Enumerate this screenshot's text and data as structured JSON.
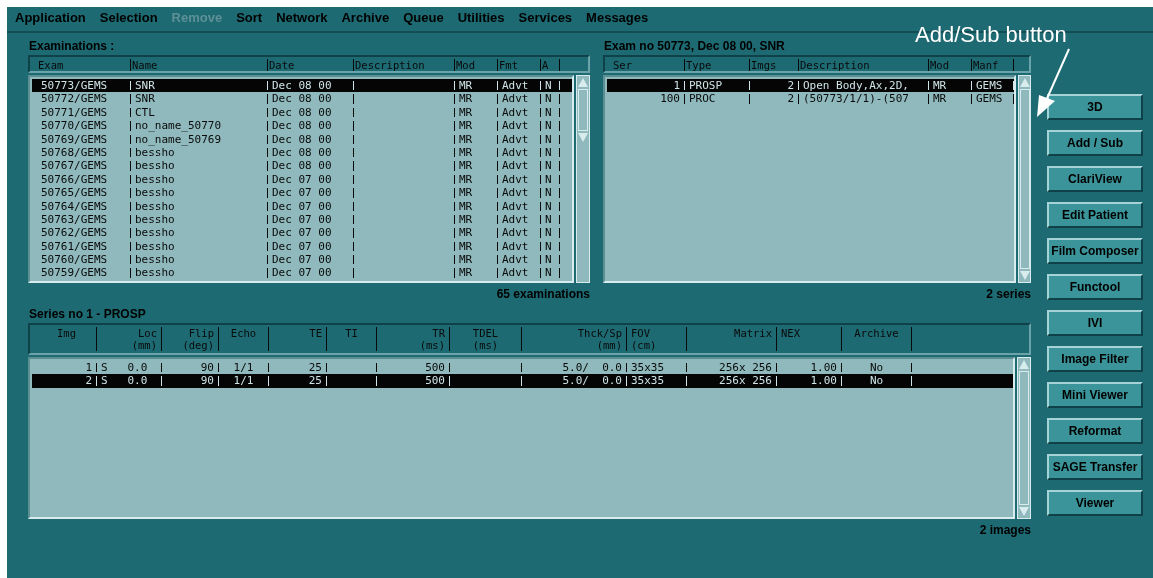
{
  "menu": [
    {
      "label": "Application",
      "disabled": false
    },
    {
      "label": "Selection",
      "disabled": false
    },
    {
      "label": "Remove",
      "disabled": true
    },
    {
      "label": "Sort",
      "disabled": false
    },
    {
      "label": "Network",
      "disabled": false
    },
    {
      "label": "Archive",
      "disabled": false
    },
    {
      "label": "Queue",
      "disabled": false
    },
    {
      "label": "Utilities",
      "disabled": false
    },
    {
      "label": "Services",
      "disabled": false
    },
    {
      "label": "Messages",
      "disabled": false
    }
  ],
  "examinations": {
    "title": "Examinations :",
    "columns": [
      "Exam",
      "Name",
      "Date",
      "Description",
      "Mod",
      "Fmt",
      "A"
    ],
    "footer": "65 examinations",
    "rows": [
      {
        "selected": true,
        "cells": [
          "50773/GEMS",
          "SNR",
          "Dec 08 00",
          "",
          "MR",
          "Advt",
          "N"
        ]
      },
      {
        "selected": false,
        "cells": [
          "50772/GEMS",
          "SNR",
          "Dec 08 00",
          "",
          "MR",
          "Advt",
          "N"
        ]
      },
      {
        "selected": false,
        "cells": [
          "50771/GEMS",
          "CTL",
          "Dec 08 00",
          "",
          "MR",
          "Advt",
          "N"
        ]
      },
      {
        "selected": false,
        "cells": [
          "50770/GEMS",
          "no_name_50770",
          "Dec 08 00",
          "",
          "MR",
          "Advt",
          "N"
        ]
      },
      {
        "selected": false,
        "cells": [
          "50769/GEMS",
          "no_name_50769",
          "Dec 08 00",
          "",
          "MR",
          "Advt",
          "N"
        ]
      },
      {
        "selected": false,
        "cells": [
          "50768/GEMS",
          "bessho",
          "Dec 08 00",
          "",
          "MR",
          "Advt",
          "N"
        ]
      },
      {
        "selected": false,
        "cells": [
          "50767/GEMS",
          "bessho",
          "Dec 08 00",
          "",
          "MR",
          "Advt",
          "N"
        ]
      },
      {
        "selected": false,
        "cells": [
          "50766/GEMS",
          "bessho",
          "Dec 07 00",
          "",
          "MR",
          "Advt",
          "N"
        ]
      },
      {
        "selected": false,
        "cells": [
          "50765/GEMS",
          "bessho",
          "Dec 07 00",
          "",
          "MR",
          "Advt",
          "N"
        ]
      },
      {
        "selected": false,
        "cells": [
          "50764/GEMS",
          "bessho",
          "Dec 07 00",
          "",
          "MR",
          "Advt",
          "N"
        ]
      },
      {
        "selected": false,
        "cells": [
          "50763/GEMS",
          "bessho",
          "Dec 07 00",
          "",
          "MR",
          "Advt",
          "N"
        ]
      },
      {
        "selected": false,
        "cells": [
          "50762/GEMS",
          "bessho",
          "Dec 07 00",
          "",
          "MR",
          "Advt",
          "N"
        ]
      },
      {
        "selected": false,
        "cells": [
          "50761/GEMS",
          "bessho",
          "Dec 07 00",
          "",
          "MR",
          "Advt",
          "N"
        ]
      },
      {
        "selected": false,
        "cells": [
          "50760/GEMS",
          "bessho",
          "Dec 07 00",
          "",
          "MR",
          "Advt",
          "N"
        ]
      },
      {
        "selected": false,
        "cells": [
          "50759/GEMS",
          "bessho",
          "Dec 07 00",
          "",
          "MR",
          "Advt",
          "N"
        ]
      }
    ]
  },
  "series": {
    "title": "Exam no 50773,  Dec 08 00, SNR",
    "columns": [
      "Ser",
      "Type",
      "Imgs",
      "Description",
      "Mod",
      "Manf"
    ],
    "footer": "2 series",
    "rows": [
      {
        "selected": true,
        "cells": [
          "1",
          "PROSP",
          "2",
          "Open Body,Ax,2D,",
          "MR",
          "GEMS"
        ]
      },
      {
        "selected": false,
        "cells": [
          "100",
          "PROC",
          "2",
          "(50773/1/1)-(507",
          "MR",
          "GEMS"
        ]
      }
    ]
  },
  "images": {
    "title": "Series no 1 - PROSP",
    "columns": [
      {
        "label": "Img"
      },
      {
        "label": "Loc",
        "unit": "(mm)"
      },
      {
        "label": "Flip",
        "unit": "(deg)"
      },
      {
        "label": "Echo"
      },
      {
        "label": "TE"
      },
      {
        "label": "TI"
      },
      {
        "label": "TR",
        "unit": "(ms)"
      },
      {
        "label": "TDEL",
        "unit": "(ms)"
      },
      {
        "label": "Thck/Sp",
        "unit": "(mm)"
      },
      {
        "label": "FOV",
        "unit": "(cm)"
      },
      {
        "label": "Matrix"
      },
      {
        "label": "NEX"
      },
      {
        "label": "Archive"
      }
    ],
    "footer": "2 images",
    "rows": [
      {
        "selected": false,
        "cells": [
          "1",
          "S   0.0",
          "90",
          "1/1",
          "25",
          "",
          "500",
          "",
          "5.0/  0.0",
          "35x35",
          "256x 256",
          "1.00",
          "No"
        ]
      },
      {
        "selected": true,
        "cells": [
          "2",
          "S   0.0",
          "90",
          "1/1",
          "25",
          "",
          "500",
          "",
          "5.0/  0.0",
          "35x35",
          "256x 256",
          "1.00",
          "No"
        ]
      }
    ]
  },
  "buttons": [
    "3D",
    "Add / Sub",
    "ClariView",
    "Edit Patient",
    "Film Composer",
    "Functool",
    "IVI",
    "Image Filter",
    "Mini Viewer",
    "Reformat",
    "SAGE Transfer",
    "Viewer"
  ],
  "annotation": "Add/Sub button"
}
